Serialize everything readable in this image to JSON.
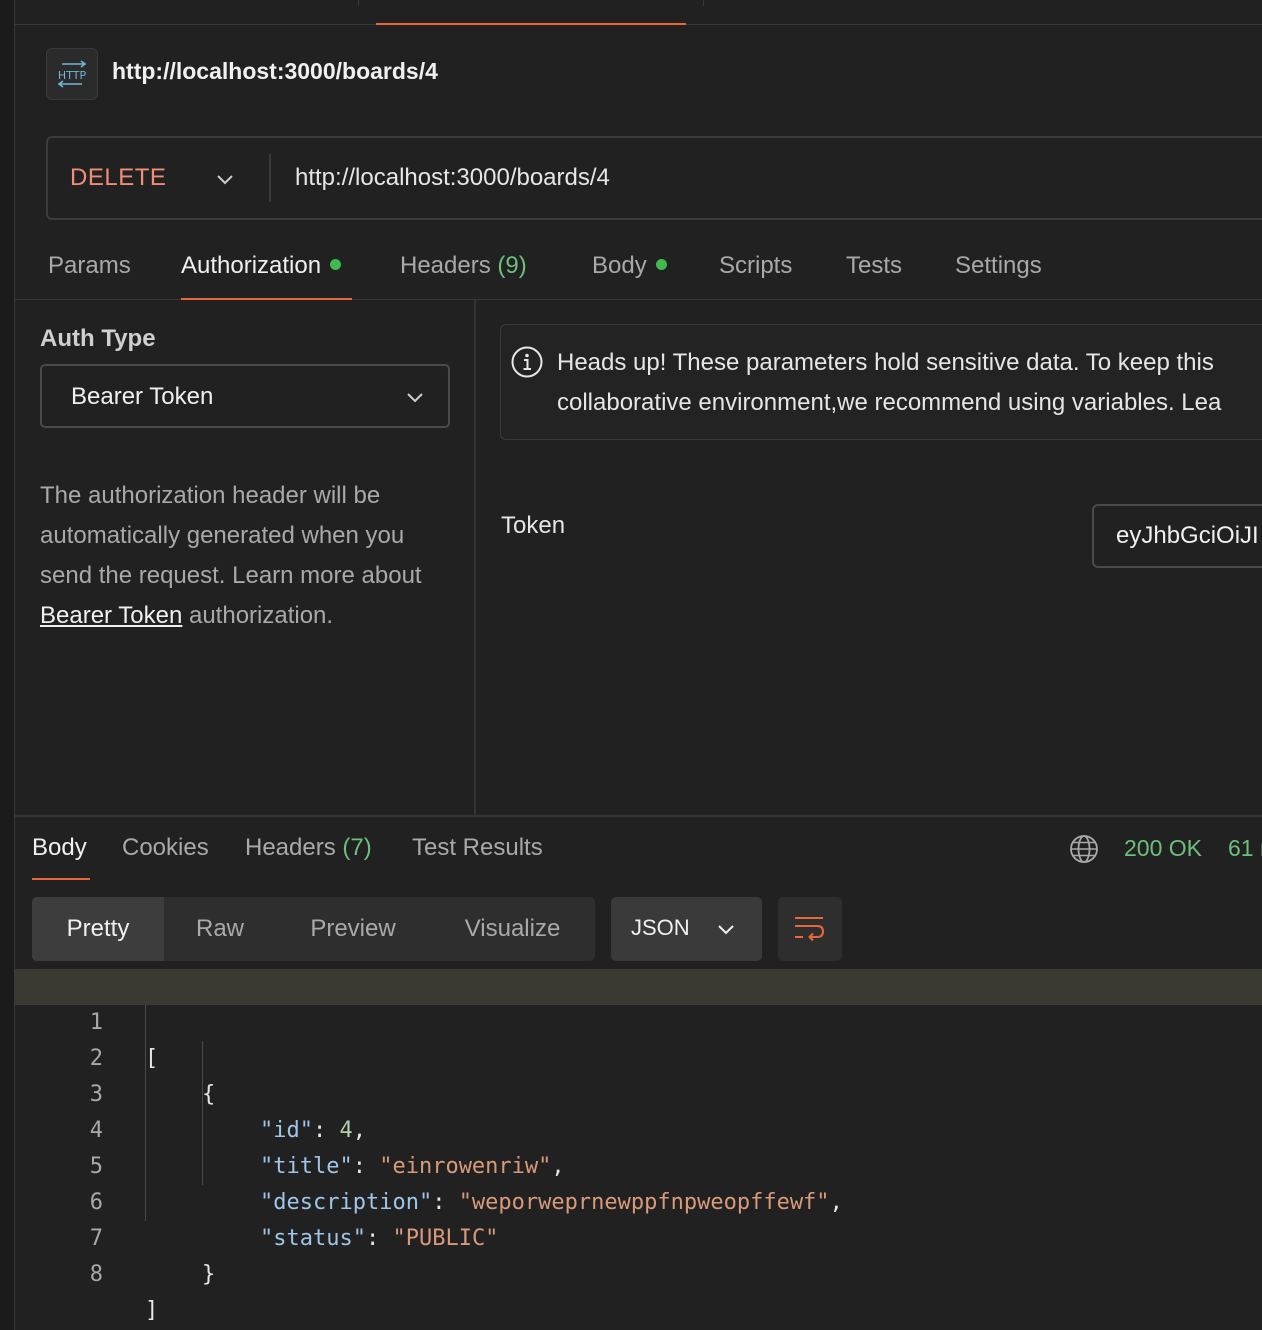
{
  "colors": {
    "accent": "#e8683c",
    "method_delete": "#f08d76",
    "success": "#6dbf7b",
    "background": "#212121"
  },
  "request": {
    "icon": "http-icon",
    "icon_label": "HTTP",
    "title": "http://localhost:3000/boards/4",
    "method": "DELETE",
    "url": "http://localhost:3000/boards/4"
  },
  "request_tabs": [
    {
      "label": "Params"
    },
    {
      "label": "Authorization",
      "dot": true
    },
    {
      "label": "Headers",
      "count": "(9)"
    },
    {
      "label": "Body",
      "dot": true
    },
    {
      "label": "Scripts"
    },
    {
      "label": "Tests"
    },
    {
      "label": "Settings"
    }
  ],
  "auth": {
    "type_label": "Auth Type",
    "type_value": "Bearer Token",
    "description_before": "The authorization header will be automatically generated when you send the request. Learn more about ",
    "description_link": "Bearer Token",
    "description_after": " authorization.",
    "info_line1": "Heads up! These parameters hold sensitive data. To keep this",
    "info_line2": "collaborative environment,we recommend using variables. Lea",
    "token_label": "Token",
    "token_value": "eyJhbGciOiJI"
  },
  "response": {
    "tabs": [
      {
        "label": "Body"
      },
      {
        "label": "Cookies"
      },
      {
        "label": "Headers",
        "count": "(7)"
      },
      {
        "label": "Test Results"
      }
    ],
    "status": "200 OK",
    "time": "61 r",
    "views": [
      "Pretty",
      "Raw",
      "Preview",
      "Visualize"
    ],
    "format": "JSON",
    "line_numbers": [
      "1",
      "2",
      "3",
      "4",
      "5",
      "6",
      "7",
      "8"
    ],
    "body": {
      "open_bracket": "[",
      "open_brace": "{",
      "fields": [
        {
          "key": "\"id\"",
          "value": "4",
          "value_type": "number",
          "trail": ","
        },
        {
          "key": "\"title\"",
          "value": "\"einrowenriw\"",
          "value_type": "string",
          "trail": ","
        },
        {
          "key": "\"description\"",
          "value": "\"weporweprnewppfnpweopffewf\"",
          "value_type": "string",
          "trail": ","
        },
        {
          "key": "\"status\"",
          "value": "\"PUBLIC\"",
          "value_type": "string",
          "trail": ""
        }
      ],
      "close_brace": "}",
      "close_bracket": "]"
    }
  }
}
